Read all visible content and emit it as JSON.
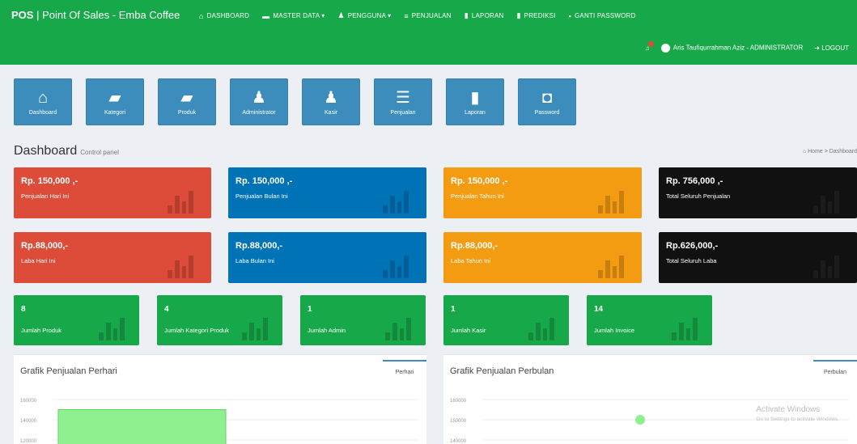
{
  "navbar": {
    "brand": "POS",
    "brand_rest": " | Point Of Sales - Emba Coffee",
    "menu": [
      {
        "icon": "home-icon",
        "glyph": "⌂",
        "label": "DASHBOARD"
      },
      {
        "icon": "folder-icon",
        "glyph": "▬",
        "label": "MASTER DATA ▾"
      },
      {
        "icon": "users-icon",
        "glyph": "♟",
        "label": "PENGGUNA ▾"
      },
      {
        "icon": "list-icon",
        "glyph": "≡",
        "label": "PENJUALAN"
      },
      {
        "icon": "file-icon",
        "glyph": "▮",
        "label": "LAPORAN"
      },
      {
        "icon": "file-icon",
        "glyph": "▮",
        "label": "PREDIKSI"
      },
      {
        "icon": "lock-icon",
        "glyph": "🔒",
        "label": "GANTI PASSWORD"
      }
    ],
    "user": "Aris Taufiqurrahman Aziz - ADMINISTRATOR",
    "logout": "LOGOUT"
  },
  "shortcuts": [
    {
      "icon": "home-icon",
      "glyph": "⌂",
      "label": "Dashboard"
    },
    {
      "icon": "folder-icon",
      "glyph": "▰",
      "label": "Kategori"
    },
    {
      "icon": "folder-icon",
      "glyph": "▰",
      "label": "Produk"
    },
    {
      "icon": "user-icon",
      "glyph": "♟",
      "label": "Administrator"
    },
    {
      "icon": "user-icon",
      "glyph": "♟",
      "label": "Kasir"
    },
    {
      "icon": "list-icon",
      "glyph": "☰",
      "label": "Penjualan"
    },
    {
      "icon": "file-icon",
      "glyph": "▮",
      "label": "Laporan"
    },
    {
      "icon": "unlock-icon",
      "glyph": "🔓",
      "label": "Password"
    }
  ],
  "header": {
    "title": "Dashboard",
    "subtitle": "Control panel",
    "breadcrumb_home": "Home",
    "breadcrumb_current": "Dashboard"
  },
  "stats": [
    {
      "value": "Rp. 150,000 ,-",
      "label": "Penjualan Hari Ini",
      "color": "#dd4b39"
    },
    {
      "value": "Rp. 150,000 ,-",
      "label": "Penjualan Bulan Ini",
      "color": "#0073b7"
    },
    {
      "value": "Rp. 150,000 ,-",
      "label": "Penjualan Tahun Ini",
      "color": "#f39c12"
    },
    {
      "value": "Rp. 756,000 ,-",
      "label": "Total Seluruh Penjualan",
      "color": "#111111"
    },
    {
      "value": "Rp.88,000,-",
      "label": "Laba Hari Ini",
      "color": "#dd4b39"
    },
    {
      "value": "Rp.88,000,-",
      "label": "Laba Bulan Ini",
      "color": "#0073b7"
    },
    {
      "value": "Rp.88,000,-",
      "label": "Laba Tahun Ini",
      "color": "#f39c12"
    },
    {
      "value": "Rp.626,000,-",
      "label": "Total Seluruh Laba",
      "color": "#111111"
    }
  ],
  "counts": [
    {
      "value": "8",
      "label": "Jumlah Produk"
    },
    {
      "value": "4",
      "label": "Jumlah Kategori Produk"
    },
    {
      "value": "1",
      "label": "Jumlah Admin"
    },
    {
      "value": "1",
      "label": "Jumlah Kasir"
    },
    {
      "value": "14",
      "label": "Jumlah Invoice"
    }
  ],
  "panels": [
    {
      "title": "Grafik Penjualan Perhari",
      "tab": "Perhari"
    },
    {
      "title": "Grafik Penjualan Perbulan",
      "tab": "Perbulan"
    }
  ],
  "watermark": {
    "title": "Activate Windows",
    "subtitle": "Go to Settings to activate Windows."
  },
  "chart_data": [
    {
      "type": "bar",
      "title": "Grafik Penjualan Perhari",
      "ytick_labels": [
        "160000",
        "140000",
        "120000"
      ],
      "series": [
        {
          "values": [
            150000
          ]
        }
      ],
      "ylim": [
        120000,
        160000
      ]
    },
    {
      "type": "line",
      "title": "Grafik Penjualan Perbulan",
      "ytick_labels": [
        "160000",
        "150000",
        "140000"
      ],
      "series": [
        {
          "values": [
            150000
          ]
        }
      ],
      "ylim": [
        140000,
        160000
      ]
    }
  ]
}
